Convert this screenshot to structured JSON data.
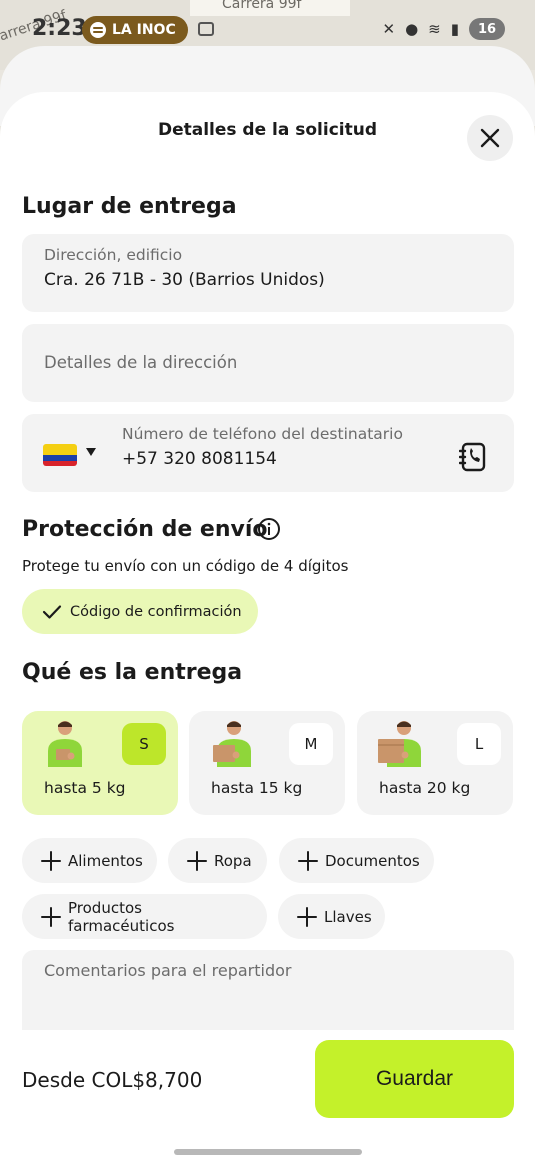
{
  "map": {
    "street_label": "Carrera 99f",
    "street_label_side": "arrera 99f"
  },
  "status_bar": {
    "time": "2:23",
    "media_label": "LA INOC",
    "battery": "16"
  },
  "sheet": {
    "title": "Detalles de la solicitud",
    "close_icon": "close-icon"
  },
  "delivery_place": {
    "heading": "Lugar de entrega",
    "address_label": "Dirección, edificio",
    "address_value": "Cra. 26 71B - 30 (Barrios Unidos)",
    "details_placeholder": "Detalles de la dirección",
    "phone_label": "Número de teléfono del destinatario",
    "phone_value": "+57 320 8081154",
    "country_flag": "colombia-flag",
    "contact_icon": "contact-book-icon"
  },
  "protection": {
    "heading": "Protección de envío",
    "info_icon": "info-icon",
    "description": "Protege tu envío con un código de 4 dígitos",
    "confirm_chip": "Código de confirmación"
  },
  "what_delivery": {
    "heading": "Qué es la entrega",
    "sizes": [
      {
        "badge": "S",
        "weight": "hasta 5 kg",
        "selected": true
      },
      {
        "badge": "M",
        "weight": "hasta 15 kg",
        "selected": false
      },
      {
        "badge": "L",
        "weight": "hasta 20 kg",
        "selected": false
      }
    ],
    "tags": [
      "Alimentos",
      "Ropa",
      "Documentos",
      "Productos farmacéuticos",
      "Llaves"
    ],
    "comments_placeholder": "Comentarios para el repartidor"
  },
  "footer": {
    "price": "Desde COL$8,700",
    "save_label": "Guardar"
  },
  "colors": {
    "accent": "#c4f12a",
    "accent_light": "#e9f8b6",
    "field_bg": "#f3f3f3"
  }
}
